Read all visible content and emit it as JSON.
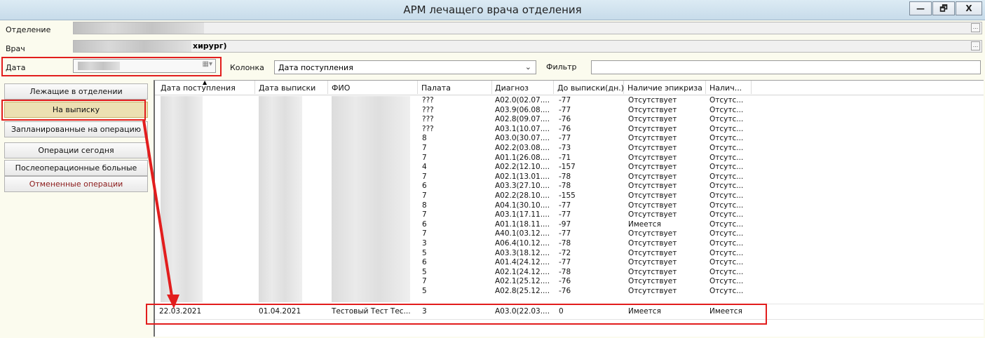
{
  "window": {
    "title": "АРМ лечащего врача отделения",
    "minimize_glyph": "—",
    "restore_glyph": "🗗",
    "close_glyph": "X"
  },
  "form": {
    "department_label": "Отделение",
    "doctor_label": "Врач",
    "doctor_value_visible": "хирург)",
    "date_label": "Дата",
    "column_label": "Колонка",
    "column_value": "Дата поступления",
    "filter_label": "Фильтр",
    "filter_value": "",
    "ellipsis": "..."
  },
  "nav": {
    "items": [
      {
        "label": "Лежащие в отделении"
      },
      {
        "label": "На выписку"
      },
      {
        "label": "Запланированные на операцию"
      },
      {
        "label": "Операции сегодня"
      },
      {
        "label": "Послеоперационные больные"
      },
      {
        "label": "Отмененные операции"
      }
    ]
  },
  "table": {
    "columns": [
      "Дата поступления",
      "Дата выписки",
      "ФИО",
      "Палата",
      "Диагноз",
      "До выписки(дн.)",
      "Наличие эпикриза",
      "Налич..."
    ],
    "rows": [
      {
        "ward": "???",
        "diagnosis": "A02.0(02.07....",
        "days": "-77",
        "epicrisis": "Отсутствует",
        "other": "Отсутс..."
      },
      {
        "ward": "???",
        "diagnosis": "A03.9(06.08....",
        "days": "-77",
        "epicrisis": "Отсутствует",
        "other": "Отсутс..."
      },
      {
        "ward": "???",
        "diagnosis": "A02.8(09.07....",
        "days": "-76",
        "epicrisis": "Отсутствует",
        "other": "Отсутс..."
      },
      {
        "ward": "???",
        "diagnosis": "A03.1(10.07....",
        "days": "-76",
        "epicrisis": "Отсутствует",
        "other": "Отсутс..."
      },
      {
        "ward": "8",
        "diagnosis": "A03.0(30.07....",
        "days": "-77",
        "epicrisis": "Отсутствует",
        "other": "Отсутс..."
      },
      {
        "ward": "7",
        "diagnosis": "A02.2(03.08....",
        "days": "-73",
        "epicrisis": "Отсутствует",
        "other": "Отсутс..."
      },
      {
        "ward": "7",
        "diagnosis": "A01.1(26.08....",
        "days": "-71",
        "epicrisis": "Отсутствует",
        "other": "Отсутс..."
      },
      {
        "ward": "4",
        "diagnosis": "A02.2(12.10....",
        "days": "-157",
        "epicrisis": "Отсутствует",
        "other": "Отсутс..."
      },
      {
        "ward": "7",
        "diagnosis": "A02.1(13.01....",
        "days": "-78",
        "epicrisis": "Отсутствует",
        "other": "Отсутс..."
      },
      {
        "ward": "6",
        "diagnosis": "A03.3(27.10....",
        "days": "-78",
        "epicrisis": "Отсутствует",
        "other": "Отсутс..."
      },
      {
        "ward": "7",
        "diagnosis": "A02.2(28.10....",
        "days": "-155",
        "epicrisis": "Отсутствует",
        "other": "Отсутс..."
      },
      {
        "ward": "8",
        "diagnosis": "A04.1(30.10....",
        "days": "-77",
        "epicrisis": "Отсутствует",
        "other": "Отсутс..."
      },
      {
        "ward": "7",
        "diagnosis": "A03.1(17.11....",
        "days": "-77",
        "epicrisis": "Отсутствует",
        "other": "Отсутс..."
      },
      {
        "ward": "6",
        "diagnosis": "A01.1(18.11....",
        "days": "-97",
        "epicrisis": "Имеется",
        "other": "Отсутс..."
      },
      {
        "ward": "7",
        "diagnosis": "A40.1(03.12....",
        "days": "-77",
        "epicrisis": "Отсутствует",
        "other": "Отсутс..."
      },
      {
        "ward": "3",
        "diagnosis": "A06.4(10.12....",
        "days": "-78",
        "epicrisis": "Отсутствует",
        "other": "Отсутс..."
      },
      {
        "ward": "5",
        "diagnosis": "A03.3(18.12....",
        "days": "-72",
        "epicrisis": "Отсутствует",
        "other": "Отсутс..."
      },
      {
        "ward": "6",
        "diagnosis": "A01.4(24.12....",
        "days": "-77",
        "epicrisis": "Отсутствует",
        "other": "Отсутс..."
      },
      {
        "ward": "5",
        "diagnosis": "A02.1(24.12....",
        "days": "-78",
        "epicrisis": "Отсутствует",
        "other": "Отсутс..."
      },
      {
        "ward": "7",
        "diagnosis": "A02.1(25.12....",
        "days": "-76",
        "epicrisis": "Отсутствует",
        "other": "Отсутс..."
      },
      {
        "ward": "5",
        "diagnosis": "A02.8(25.12....",
        "days": "-76",
        "epicrisis": "Отсутствует",
        "other": "Отсутс..."
      }
    ],
    "highlighted_row": {
      "admission": "22.03.2021",
      "discharge": "01.04.2021",
      "name": "Тестовый Тест Тес...",
      "ward": "3",
      "diagnosis": "A03.0(22.03....",
      "days": "0",
      "epicrisis": "Имеется",
      "other": "Имеется"
    }
  },
  "colors": {
    "annotation_red": "#e21d1d",
    "active_nav": "#ecdfb2",
    "background": "#fbfbee"
  }
}
